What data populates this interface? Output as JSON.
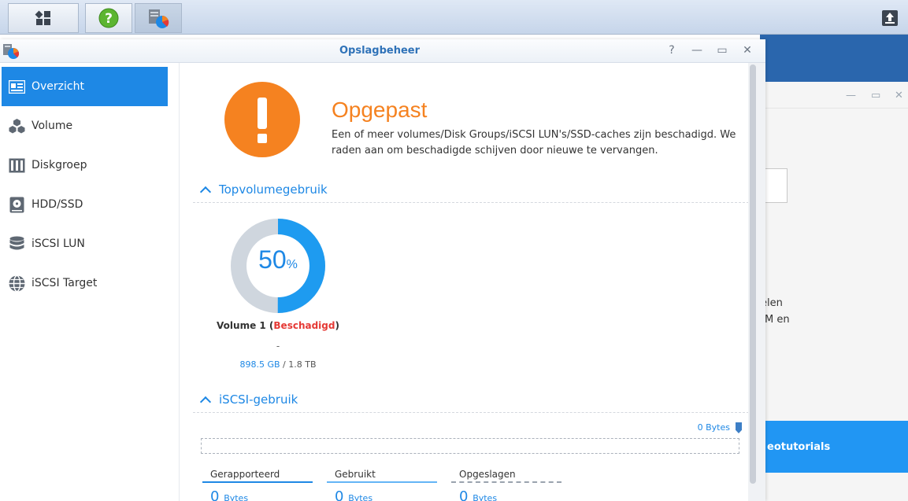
{
  "window": {
    "title": "Opslagbeheer"
  },
  "sidebar": {
    "items": [
      {
        "label": "Overzicht",
        "icon": "overview-icon",
        "active": true
      },
      {
        "label": "Volume",
        "icon": "cubes-icon"
      },
      {
        "label": "Diskgroep",
        "icon": "diskgroup-icon"
      },
      {
        "label": "HDD/SSD",
        "icon": "hdd-icon"
      },
      {
        "label": "iSCSI LUN",
        "icon": "database-icon"
      },
      {
        "label": "iSCSI Target",
        "icon": "globe-icon"
      }
    ]
  },
  "alert": {
    "title": "Opgepast",
    "description": "Een of meer volumes/Disk Groups/iSCSI LUN's/SSD-caches zijn beschadigd. We raden aan om beschadigde schijven door nieuwe te vervangen."
  },
  "volume_usage": {
    "heading": "Topvolumegebruik",
    "percent": 50,
    "percent_text": "50",
    "percent_unit": "%",
    "name": "Volume 1",
    "status": "Beschadigd",
    "dash": "-",
    "used": "898.5 GB",
    "total": "/ 1.8 TB"
  },
  "iscsi_usage": {
    "heading": "iSCSI-gebruik",
    "bytes_label": "0 Bytes",
    "legend": [
      {
        "label": "Gerapporteerd",
        "value": "0",
        "unit": "Bytes"
      },
      {
        "label": "Gebruikt",
        "value": "0",
        "unit": "Bytes"
      },
      {
        "label": "Opgeslagen",
        "value": "0",
        "unit": "Bytes"
      }
    ]
  },
  "background_window": {
    "text_line1": "elen",
    "text_line2": "M en",
    "banner": "eotutorials"
  },
  "colors": {
    "accent": "#1e88e5",
    "warning": "#f58220",
    "danger": "#e53935"
  }
}
